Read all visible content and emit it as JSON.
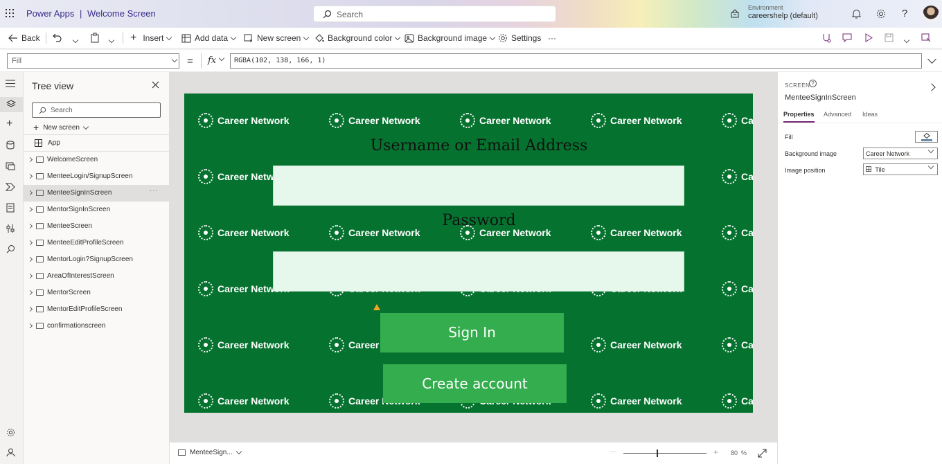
{
  "header": {
    "app_name": "Power Apps",
    "separator": "|",
    "screen_title": "Welcome Screen",
    "search_placeholder": "Search",
    "env_label": "Environment",
    "env_value": "careershelp (default)"
  },
  "toolbar": {
    "back": "Back",
    "insert": "Insert",
    "add_data": "Add data",
    "new_screen": "New screen",
    "background_color": "Background color",
    "background_image": "Background image",
    "settings": "Settings",
    "more": "···"
  },
  "formula": {
    "property": "Fill",
    "equals": "=",
    "fx": "fx",
    "value": "RGBA(102, 138, 166, 1)"
  },
  "tree": {
    "title": "Tree view",
    "search_placeholder": "Search",
    "new_screen": "New screen",
    "app": "App",
    "screens": [
      {
        "name": "WelcomeScreen"
      },
      {
        "name": "MenteeLogin/SignupScreen"
      },
      {
        "name": "MenteeSignInScreen",
        "selected": true
      },
      {
        "name": "MentorSignInScreen"
      },
      {
        "name": "MenteeScreen"
      },
      {
        "name": "MenteeEditProfileScreen"
      },
      {
        "name": "MentorLogin?SignupScreen"
      },
      {
        "name": "AreaOfInterestScreen"
      },
      {
        "name": "MentorScreen"
      },
      {
        "name": "MentorEditProfileScreen"
      },
      {
        "name": "confirmationscreen"
      }
    ]
  },
  "canvas": {
    "tile_text": "Career Network",
    "bg_color": "#06722f",
    "username_label": "Username or Email Address",
    "password_label": "Password",
    "sign_in": "Sign In",
    "create_account": "Create account",
    "button_color": "#33ad4d"
  },
  "bottom": {
    "screen_selector": "MenteeSign...",
    "zoom_minus": "—",
    "zoom_plus": "+",
    "zoom_value": "80",
    "zoom_unit": "%"
  },
  "properties": {
    "section": "SCREEN",
    "screen_name": "MenteeSignInScreen",
    "tabs": [
      "Properties",
      "Advanced",
      "Ideas"
    ],
    "fill_label": "Fill",
    "bg_image_label": "Background image",
    "bg_image_value": "Career Network",
    "image_position_label": "Image position",
    "image_position_value": "Tile"
  }
}
